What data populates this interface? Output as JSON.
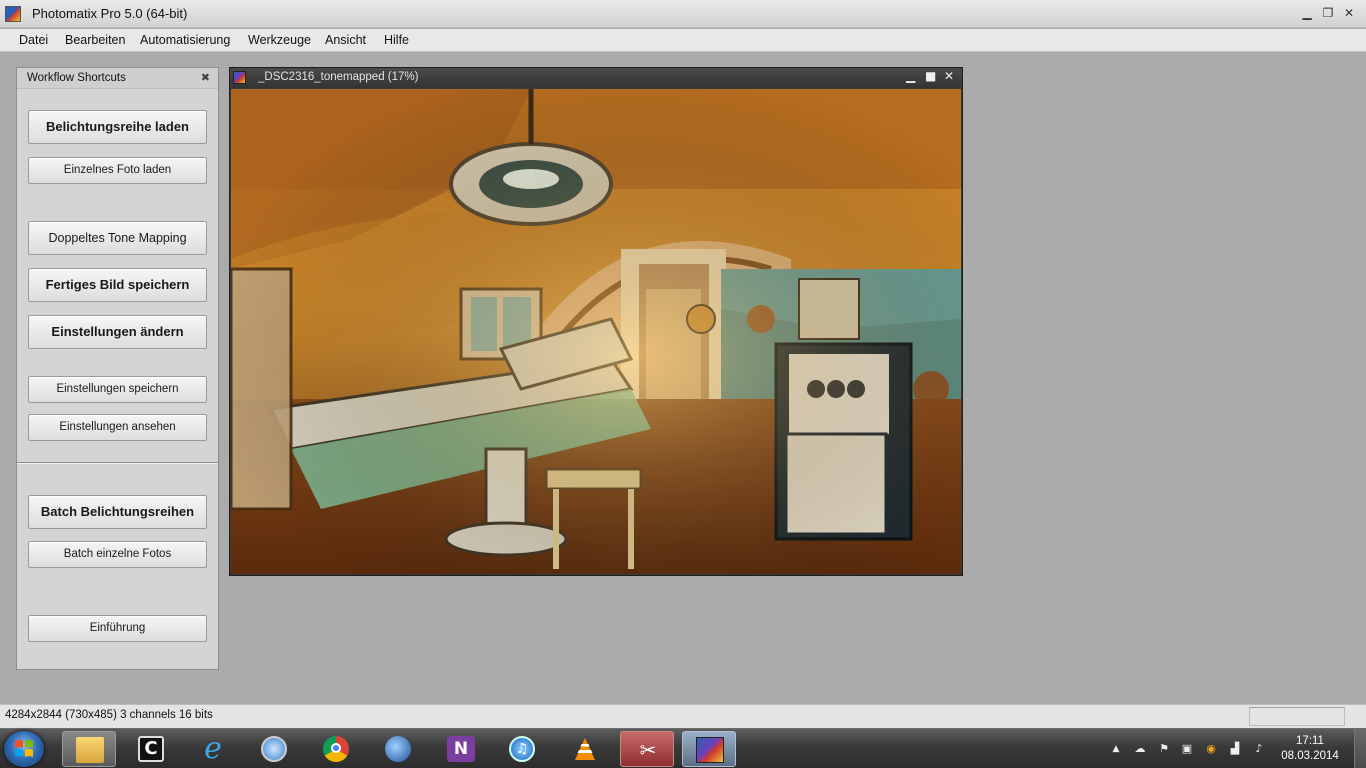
{
  "window": {
    "title": "Photomatix Pro 5.0 (64-bit)",
    "controls": {
      "minimize": "▁",
      "restore": "❐",
      "close": "✕"
    }
  },
  "menu": [
    "Datei",
    "Bearbeiten",
    "Automatisierung",
    "Werkzeuge",
    "Ansicht",
    "Hilfe"
  ],
  "workflow_panel": {
    "title": "Workflow Shortcuts",
    "close_glyph": "✖",
    "buttons": {
      "load_bracketed": "Belichtungsreihe laden",
      "load_single": "Einzelnes Foto laden",
      "double_tonemap": "Doppeltes Tone Mapping",
      "save_final": "Fertiges Bild speichern",
      "change_settings": "Einstellungen ändern",
      "save_settings": "Einstellungen speichern",
      "view_settings": "Einstellungen ansehen",
      "batch_bracketed": "Batch Belichtungsreihen",
      "batch_single": "Batch einzelne Fotos",
      "intro": "Einführung"
    }
  },
  "image_window": {
    "title": "_DSC2316_tonemapped (17%)",
    "controls": {
      "minimize": "▁",
      "maximize": "■",
      "close": "✕"
    }
  },
  "status": {
    "text": "4284x2844 (730x485) 3 channels 16 bits"
  },
  "taskbar": {
    "apps": [
      "windows-explorer",
      "app-c",
      "internet-explorer",
      "safari",
      "chrome",
      "thunderbird",
      "onenote",
      "itunes",
      "vlc",
      "snipping-tool",
      "photomatix"
    ],
    "tray_icons": [
      "show-hidden-icons",
      "cloud",
      "action-center",
      "device",
      "avast",
      "signal",
      "volume"
    ],
    "tray_glyphs": {
      "show_hidden": "▲",
      "cloud": "☁",
      "action_center": "⚑",
      "device": "▣",
      "avast": "◉",
      "signal": "▟",
      "volume": "♪"
    },
    "time": "17:11",
    "date": "08.03.2014"
  }
}
